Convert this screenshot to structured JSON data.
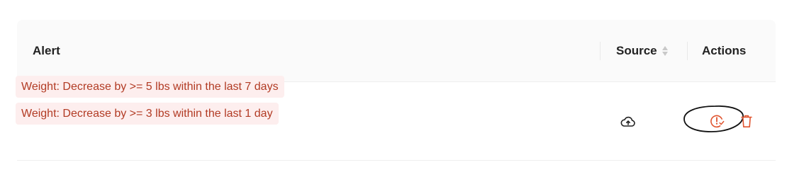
{
  "table": {
    "columns": {
      "alert": "Alert",
      "source": "Source",
      "actions": "Actions"
    },
    "rows": [
      {
        "alerts": [
          "Weight: Decrease by >= 5 lbs within the last 7 days",
          "Weight: Decrease by >= 3 lbs within the last 1 day"
        ],
        "source_icon": "cloud-upload-icon",
        "actions": [
          "acknowledge-alert-icon",
          "delete-icon"
        ]
      }
    ]
  },
  "colors": {
    "tag_background": "#fdeeee",
    "tag_text": "#b23b24",
    "action_icon": "#e0542f",
    "header_background": "#fafafa"
  }
}
